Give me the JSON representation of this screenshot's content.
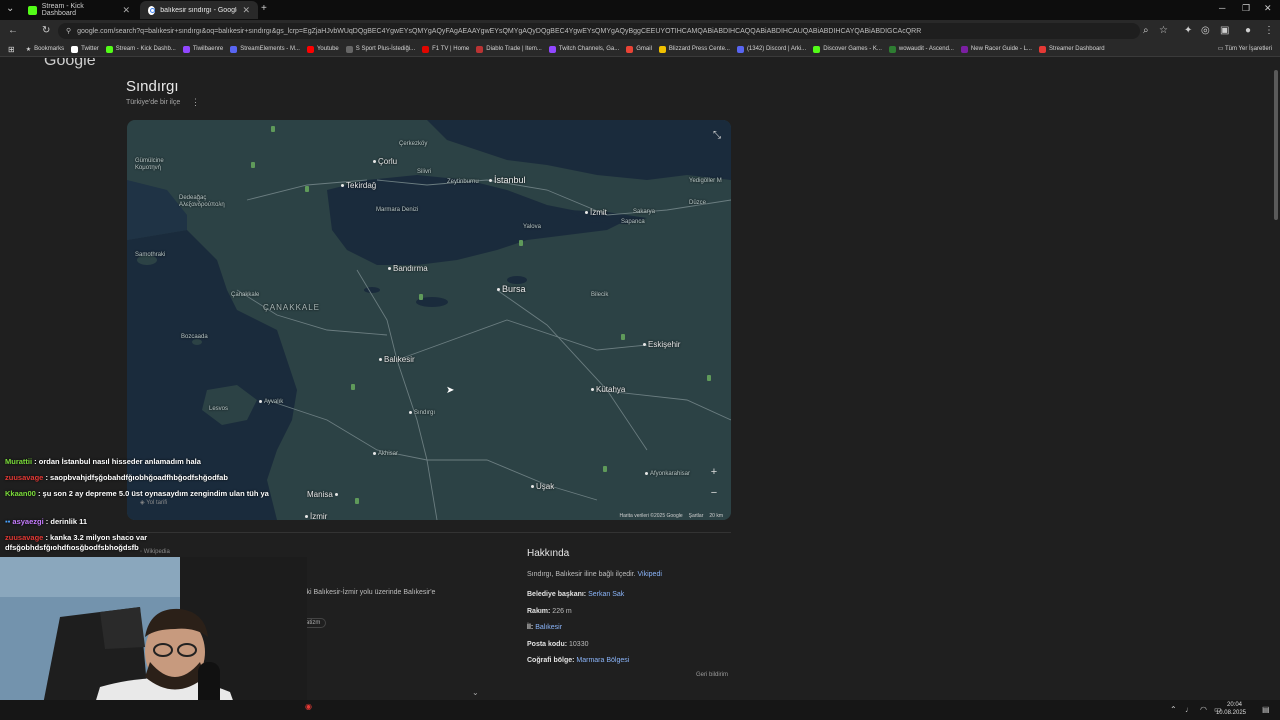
{
  "browser": {
    "tabs": [
      {
        "title": "Stream - Kick Dashboard",
        "active": false
      },
      {
        "title": "balıkesir sındırgı - Google'da A",
        "active": true
      }
    ],
    "url": "google.com/search?q=balıkesir+sındırgı&oq=balıkesir+sındırgı&gs_lcrp=EgZjaHJvbWUqDQgBEC4YgwEYsQMYgAQyFAgAEAAYgwEYsQMYgAQyDQgBEC4YgwEYsQMYgAQyBggCEEUYOTIHCAMQABiABDIHCAQQABiABDIHCAUQABiABDIHCAYQABiABDIGCAcQRR",
    "bookmarks": [
      {
        "label": "Bookmarks",
        "color": "#cccccc"
      },
      {
        "label": "Twitter",
        "color": "#ffffff"
      },
      {
        "label": "Stream - Kick Dashb...",
        "color": "#53fc18"
      },
      {
        "label": "Tiwilbaenre",
        "color": "#9147ff"
      },
      {
        "label": "StreamElements - M...",
        "color": "#5865f2"
      },
      {
        "label": "Youtube",
        "color": "#ff0000"
      },
      {
        "label": "S Sport Plus-İstediği...",
        "color": "#444444"
      },
      {
        "label": "F1 TV | Home",
        "color": "#e10600"
      },
      {
        "label": "Diablo Trade | Item...",
        "color": "#b33"
      },
      {
        "label": "Twitch Channels, Ga...",
        "color": "#9147ff"
      },
      {
        "label": "Gmail",
        "color": "#ea4335"
      },
      {
        "label": "Blizzard Press Cente...",
        "color": "#f0c000"
      },
      {
        "label": "(1342) Discord | Arki...",
        "color": "#5865f2"
      },
      {
        "label": "Discover Games - K...",
        "color": "#53fc18"
      },
      {
        "label": "wowaudit - Ascend...",
        "color": "#2e7d32"
      },
      {
        "label": "New Racer Guide - L...",
        "color": "#7b1fa2"
      },
      {
        "label": "Streamer Dashboard",
        "color": "#e53935"
      }
    ],
    "all_bookmarks": "Tüm Yer İşaretleri"
  },
  "page": {
    "logo": "Google",
    "title": "Sındırgı",
    "subtitle": "Türkiye'de bir ilçe",
    "map": {
      "cities": [
        {
          "name": "Çorlu",
          "size": "normal"
        },
        {
          "name": "Çerkezköy",
          "size": "small"
        },
        {
          "name": "Silivri",
          "size": "small"
        },
        {
          "name": "İstanbul",
          "size": "big"
        },
        {
          "name": "Zeytinburnu",
          "size": "small"
        },
        {
          "name": "Tekirdağ",
          "size": "normal"
        },
        {
          "name": "Gümülcine\nΚομοτηνή",
          "size": "small"
        },
        {
          "name": "Dedeağaç\nΑλεξανδρούπολη",
          "size": "small"
        },
        {
          "name": "Marmara Denizi",
          "size": "small"
        },
        {
          "name": "İzmit",
          "size": "normal"
        },
        {
          "name": "Sakarya",
          "size": "small"
        },
        {
          "name": "Sapanca",
          "size": "small"
        },
        {
          "name": "Yedigöller M",
          "size": "small"
        },
        {
          "name": "Düzce",
          "size": "small"
        },
        {
          "name": "Yalova",
          "size": "small"
        },
        {
          "name": "Samothraki",
          "size": "small"
        },
        {
          "name": "Bandırma",
          "size": "normal"
        },
        {
          "name": "Bursa",
          "size": "big"
        },
        {
          "name": "Bilecik",
          "size": "small"
        },
        {
          "name": "Çanakkale",
          "size": "small"
        },
        {
          "name": "ÇANAKKALE",
          "size": "region"
        },
        {
          "name": "Bozcaada",
          "size": "small"
        },
        {
          "name": "Eskişehir",
          "size": "normal"
        },
        {
          "name": "Balıkesir",
          "size": "normal"
        },
        {
          "name": "Kütahya",
          "size": "normal"
        },
        {
          "name": "Ayvalık",
          "size": "small"
        },
        {
          "name": "Lesvos",
          "size": "small"
        },
        {
          "name": "Sındırgı",
          "size": "small"
        },
        {
          "name": "Akhisar",
          "size": "small"
        },
        {
          "name": "Afyonkarahisar",
          "size": "small"
        },
        {
          "name": "Manisa",
          "size": "normal"
        },
        {
          "name": "Uşak",
          "size": "normal"
        },
        {
          "name": "İzmir",
          "size": "normal"
        }
      ],
      "attribution": "Harita verileri ©2025 Google",
      "terms": "Şartlar",
      "scale": "20 km",
      "zoom_in": "+",
      "zoom_out": "−"
    },
    "about": {
      "heading": "Hakkında",
      "description": "Sındırgı, Balıkesir iline bağlı ilçedir.",
      "description_link": "Vikipedi",
      "facts": [
        {
          "label": "Belediye başkanı:",
          "value": "Serkan Sak"
        },
        {
          "label": "Rakım:",
          "value": "226 m"
        },
        {
          "label": "İl:",
          "value": "Balıkesir"
        },
        {
          "label": "Posta kodu:",
          "value": "10330"
        },
        {
          "label": "Coğrafi bölge:",
          "value": "Marmara Bölgesi"
        }
      ],
      "feedback": "Geri bildirim"
    },
    "left_snippet": "olup, eski Balıkesir-İzmir yolu üzerinde Balıkesir'e",
    "left_chip": "atizm",
    "wiki_label": "Wikipedia",
    "directions_label": "Yol tarifi"
  },
  "chat": [
    {
      "user": "Murattii",
      "color": "#7bdc3a",
      "text": "ordan İstanbul nasıl hisseder anlamadım hala"
    },
    {
      "user": "zuusavage",
      "color": "#e53935",
      "text": "saopbvahjdfşğobahdfğıobhğoadfhbğodfshğodfab"
    },
    {
      "user": "Kkaan00",
      "color": "#7bdc3a",
      "text": "şu son 2 ay depreme 5.0 üst oynasaydım zengindim ulan tüh ya"
    },
    {
      "user": "asyaezgi",
      "color": "#c77dff",
      "text": "derinlik 11"
    },
    {
      "user": "zuusavage",
      "color": "#e53935",
      "text": "kanka 3.2 milyon shaco var dfsğobhdsfğıohdfıosğbodfsbhoğdsfb"
    }
  ],
  "taskbar": {
    "time": "20:04",
    "date": "10.08.2025"
  }
}
